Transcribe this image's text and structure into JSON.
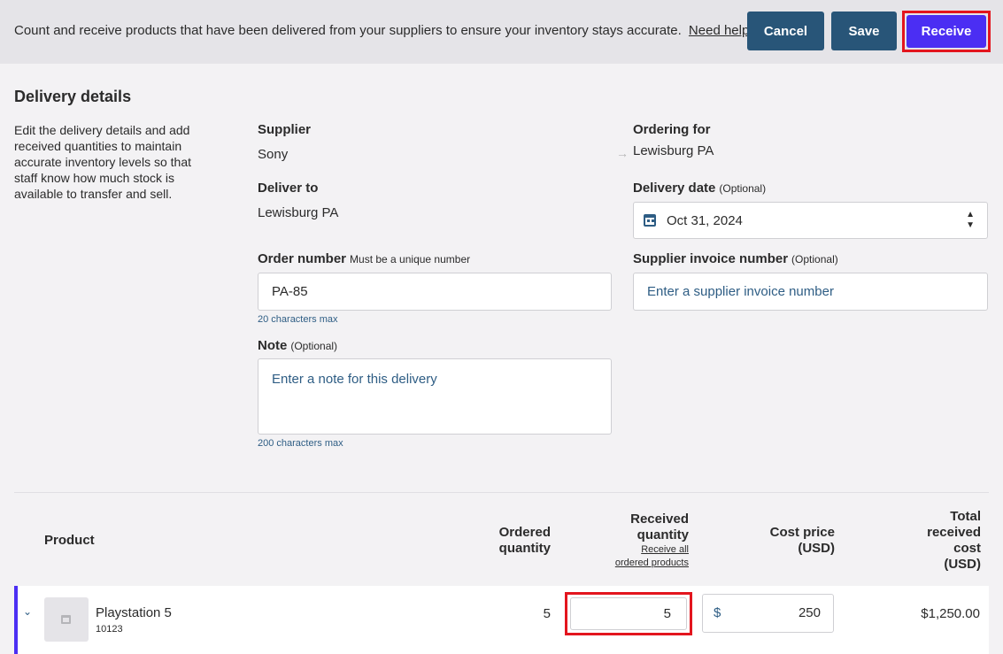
{
  "header": {
    "intro_text": "Count and receive products that have been delivered from your suppliers to ensure your inventory stays accurate.",
    "help_link": "Need help?",
    "cancel_label": "Cancel",
    "save_label": "Save",
    "receive_label": "Receive"
  },
  "delivery": {
    "title": "Delivery details",
    "description": "Edit the delivery details and add received quantities to maintain accurate inventory levels so that staff know how much stock is available to transfer and sell.",
    "supplier_label": "Supplier",
    "supplier_value": "Sony",
    "ordering_for_label": "Ordering for",
    "ordering_for_value": "Lewisburg PA",
    "deliver_to_label": "Deliver to",
    "deliver_to_value": "Lewisburg PA",
    "delivery_date_label": "Delivery date",
    "delivery_date_hint": "(Optional)",
    "delivery_date_value": "Oct 31, 2024",
    "order_number_label": "Order number",
    "order_number_hint": "Must be a unique number",
    "order_number_value": "PA-85",
    "order_number_helper": "20 characters max",
    "supplier_invoice_label": "Supplier invoice number",
    "supplier_invoice_hint": "(Optional)",
    "supplier_invoice_placeholder": "Enter a supplier invoice number",
    "note_label": "Note",
    "note_hint": "(Optional)",
    "note_placeholder": "Enter a note for this delivery",
    "note_helper": "200 characters max"
  },
  "table": {
    "col_product": "Product",
    "col_ordered_line1": "Ordered",
    "col_ordered_line2": "quantity",
    "col_received_line1": "Received",
    "col_received_line2": "quantity",
    "receive_all_line1": "Receive all",
    "receive_all_line2": "ordered products",
    "col_cost_line1": "Cost price",
    "col_cost_line2": "(USD)",
    "col_total_line1": "Total",
    "col_total_line2": "received",
    "col_total_line3": "cost",
    "col_total_line4": "(USD)",
    "rows": [
      {
        "name": "Playstation 5",
        "sku": "10123",
        "ordered_quantity": "5",
        "received_quantity": "5",
        "currency_symbol": "$",
        "cost_price": "250",
        "total_cost": "$1,250.00"
      }
    ]
  },
  "colors": {
    "primary_button": "#285578",
    "receive_button": "#4b2ef3",
    "highlight_border": "#e3151e",
    "link_blue": "#2e5d84"
  },
  "icons": {
    "arrow": "right-arrow-icon",
    "calendar": "calendar-icon",
    "stepper": "stepper-icon",
    "chevron": "chevron-down-icon",
    "product_image": "product-placeholder-icon"
  }
}
